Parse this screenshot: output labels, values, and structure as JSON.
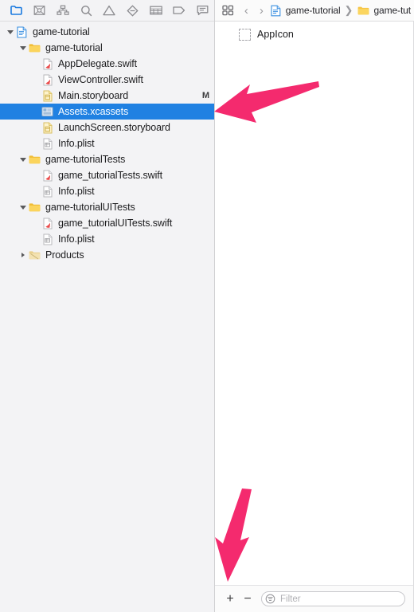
{
  "navigator": {
    "toolbar_icons": [
      {
        "name": "folder-icon",
        "label": "Project navigator"
      },
      {
        "name": "source-control-icon",
        "label": "Source control navigator"
      },
      {
        "name": "hierarchy-icon",
        "label": "Symbol navigator"
      },
      {
        "name": "search-icon",
        "label": "Find navigator"
      },
      {
        "name": "warning-icon",
        "label": "Issue navigator"
      },
      {
        "name": "diamond-icon",
        "label": "Test navigator"
      },
      {
        "name": "list-icon",
        "label": "Debug navigator"
      },
      {
        "name": "tag-icon",
        "label": "Breakpoint navigator"
      },
      {
        "name": "report-icon",
        "label": "Report navigator"
      }
    ],
    "tree": [
      {
        "label": "game-tutorial",
        "depth": 0,
        "icon": "project-icon",
        "twisty": "open",
        "status": ""
      },
      {
        "label": "game-tutorial",
        "depth": 1,
        "icon": "folder-icon",
        "twisty": "open",
        "status": ""
      },
      {
        "label": "AppDelegate.swift",
        "depth": 2,
        "icon": "swift-icon",
        "twisty": "none",
        "status": ""
      },
      {
        "label": "ViewController.swift",
        "depth": 2,
        "icon": "swift-icon",
        "twisty": "none",
        "status": ""
      },
      {
        "label": "Main.storyboard",
        "depth": 2,
        "icon": "storyboard-icon",
        "twisty": "none",
        "status": "M"
      },
      {
        "label": "Assets.xcassets",
        "depth": 2,
        "icon": "xcassets-icon",
        "twisty": "none",
        "status": "",
        "selected": true
      },
      {
        "label": "LaunchScreen.storyboard",
        "depth": 2,
        "icon": "storyboard-icon",
        "twisty": "none",
        "status": ""
      },
      {
        "label": "Info.plist",
        "depth": 2,
        "icon": "plist-icon",
        "twisty": "none",
        "status": ""
      },
      {
        "label": "game-tutorialTests",
        "depth": 1,
        "icon": "folder-icon",
        "twisty": "open",
        "status": ""
      },
      {
        "label": "game_tutorialTests.swift",
        "depth": 2,
        "icon": "swift-icon",
        "twisty": "none",
        "status": ""
      },
      {
        "label": "Info.plist",
        "depth": 2,
        "icon": "plist-icon",
        "twisty": "none",
        "status": ""
      },
      {
        "label": "game-tutorialUITests",
        "depth": 1,
        "icon": "folder-icon",
        "twisty": "open",
        "status": ""
      },
      {
        "label": "game_tutorialUITests.swift",
        "depth": 2,
        "icon": "swift-icon",
        "twisty": "none",
        "status": ""
      },
      {
        "label": "Info.plist",
        "depth": 2,
        "icon": "plist-icon",
        "twisty": "none",
        "status": ""
      },
      {
        "label": "Products",
        "depth": 1,
        "icon": "folder-gray-icon",
        "twisty": "closed",
        "status": ""
      }
    ]
  },
  "editor": {
    "jumpbar": {
      "grid_icon": "related-items-icon",
      "back_label": "‹",
      "forward_label": "›",
      "crumbs": [
        {
          "label": "game-tutorial",
          "icon": "project-icon"
        },
        {
          "label": "game-tut",
          "icon": "folder-icon"
        }
      ],
      "separator": "❯"
    },
    "assets": [
      {
        "label": "AppIcon",
        "icon": "asset-placeholder-icon"
      }
    ],
    "bottom_bar": {
      "add_label": "+",
      "remove_label": "−",
      "filter_icon": "filter-icon",
      "filter_placeholder": "Filter"
    }
  },
  "annotations": {
    "arrow_color": "#F42A6E",
    "arrows": [
      {
        "name": "arrow-pointing-to-assets-xcassets",
        "direction": "left"
      },
      {
        "name": "arrow-pointing-to-add-button",
        "direction": "down-left"
      }
    ]
  }
}
